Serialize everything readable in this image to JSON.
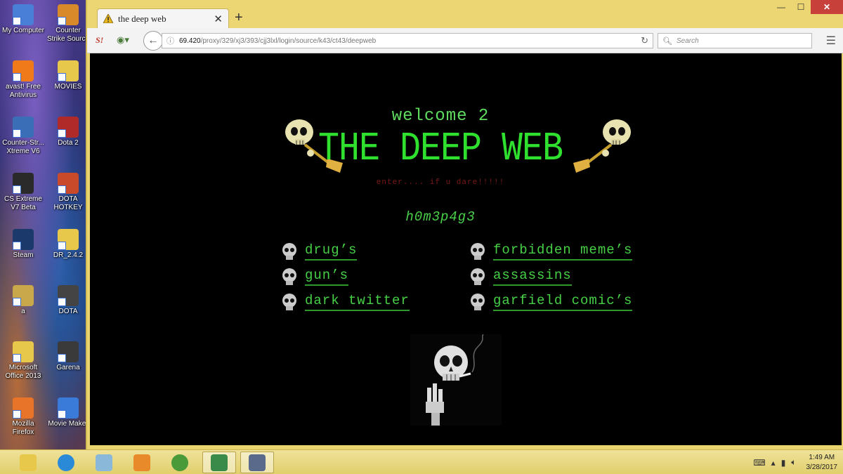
{
  "desktop": {
    "icons": [
      {
        "label": "My Computer",
        "icon": "computer-icon",
        "color": "#4a7fd8"
      },
      {
        "label": "Counter Strike Source",
        "icon": "game-icon",
        "color": "#d88a2a"
      },
      {
        "label": "avast! Free Antivirus",
        "icon": "antivirus-icon",
        "color": "#f07a1a"
      },
      {
        "label": "MOVIES",
        "icon": "folder-icon",
        "color": "#e8c84a"
      },
      {
        "label": "Counter-Str... Xtreme V6",
        "icon": "game-icon",
        "color": "#3a6fb8"
      },
      {
        "label": "Dota 2",
        "icon": "game-icon",
        "color": "#b02a2a"
      },
      {
        "label": "CS Extreme V7 Beta",
        "icon": "game-icon",
        "color": "#2a2a2a"
      },
      {
        "label": "DOTA HOTKEY",
        "icon": "app-icon",
        "color": "#c84a2a"
      },
      {
        "label": "Steam",
        "icon": "steam-icon",
        "color": "#1b3a6b"
      },
      {
        "label": "DR_2.4.2",
        "icon": "folder-icon",
        "color": "#e8c84a"
      },
      {
        "label": "a",
        "icon": "file-icon",
        "color": "#c8a84a"
      },
      {
        "label": "DOTA",
        "icon": "game-icon",
        "color": "#444444"
      },
      {
        "label": "Microsoft Office 2013",
        "icon": "folder-icon",
        "color": "#e8c84a"
      },
      {
        "label": "Garena",
        "icon": "app-icon",
        "color": "#3a3a3a"
      },
      {
        "label": "Mozilla Firefox",
        "icon": "firefox-icon",
        "color": "#e8742a"
      },
      {
        "label": "Movie Maker",
        "icon": "app-icon",
        "color": "#3a7ad8"
      }
    ]
  },
  "browser": {
    "tab_title": "the deep web",
    "url_host": "69.420",
    "url_path": "/proxy/329/xj3/393/cjj3lxl/login/source/k43/ct43/deepweb",
    "search_placeholder": "Search",
    "new_tab": "+",
    "tab_close": "✕"
  },
  "page": {
    "welcome": "welcome 2",
    "headline": "THE DEEP WEB",
    "tagline": "enter.... if u dare!!!!!",
    "homepage": "h0m3p4g3",
    "links_left": [
      "drug’s",
      "gun’s",
      "dark twitter"
    ],
    "links_right": [
      "forbidden meme’s",
      "assassins",
      "garfield comic’s"
    ]
  },
  "taskbar": {
    "apps": [
      {
        "name": "file-explorer-icon",
        "color": "#e8c84a"
      },
      {
        "name": "internet-explorer-icon",
        "color": "#2a8ad8"
      },
      {
        "name": "app-icon",
        "color": "#8ab8d8"
      },
      {
        "name": "media-player-icon",
        "color": "#e88a2a"
      },
      {
        "name": "chrome-icon",
        "color": "#4a9a3a"
      },
      {
        "name": "tor-browser-icon",
        "color": "#3a8a4a"
      },
      {
        "name": "settings-icon",
        "color": "#5a6a8a"
      }
    ],
    "time": "1:49 AM",
    "date": "3/28/2017"
  },
  "colors": {
    "page_bg": "#000000",
    "neon_green": "#2fe02f",
    "tagline_red": "#7a1a1a",
    "window_frame": "#e9d470"
  }
}
